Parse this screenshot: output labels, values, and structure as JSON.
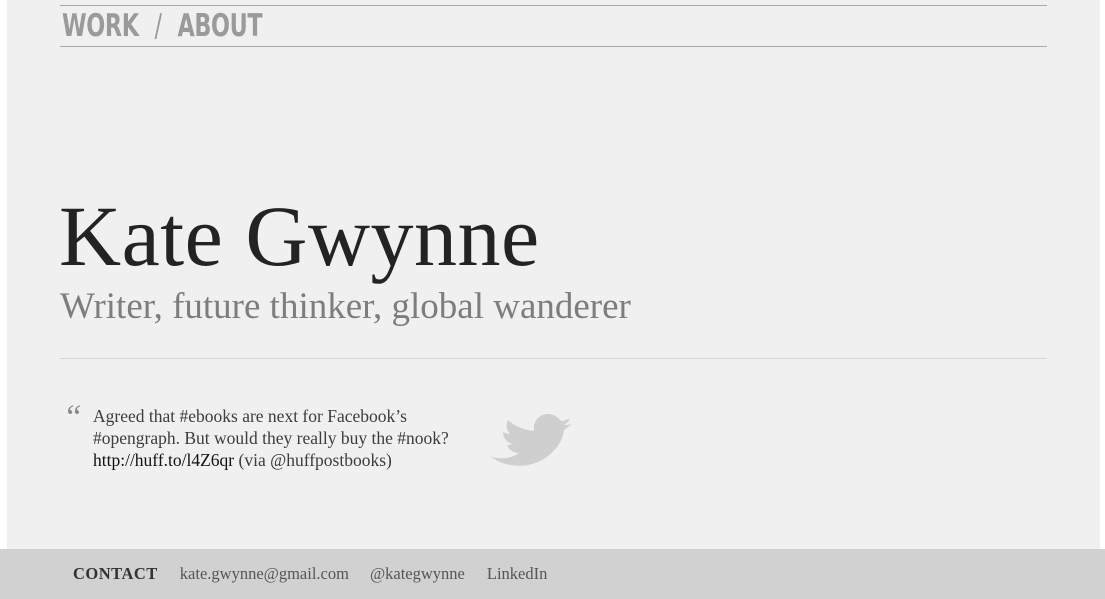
{
  "nav": {
    "work_label": "WORK",
    "separator": "/",
    "about_label": "ABOUT"
  },
  "hero": {
    "name": "Kate Gwynne",
    "tagline": "Writer, future thinker, global wanderer"
  },
  "tweet": {
    "quote_mark": "“",
    "text": "Agreed that #ebooks are next for Facebook’s #opengraph. But would they really buy the #nook?",
    "link_text": "http://huff.to/l4Z6qr",
    "via_text": "(via @huffpostbooks)",
    "icon": "twitter-bird-icon",
    "icon_color": "#cfcfcf"
  },
  "footer": {
    "contact_label": "CONTACT",
    "email": "kate.gwynne@gmail.com",
    "twitter_handle": "@kategwynne",
    "linkedin_label": "LinkedIn"
  },
  "colors": {
    "page_background": "#f0f0f0",
    "footer_background": "#d1d1d1",
    "name_text": "#232323",
    "tagline_text": "#7d7d7d",
    "nav_text": "#9a9a9a"
  }
}
